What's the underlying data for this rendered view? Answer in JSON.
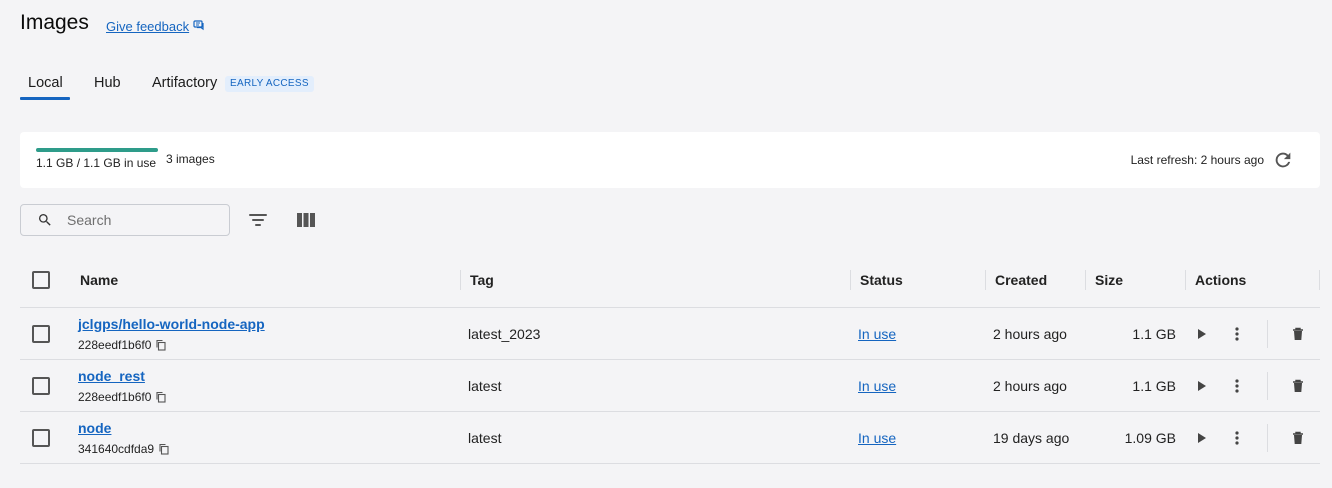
{
  "header": {
    "title": "Images",
    "feedback_label": "Give feedback"
  },
  "tabs": [
    {
      "label": "Local",
      "active": true
    },
    {
      "label": "Hub",
      "active": false
    },
    {
      "label": "Artifactory",
      "active": false,
      "badge": "EARLY ACCESS"
    }
  ],
  "disk": {
    "usage_text": "1.1 GB / 1.1 GB in use",
    "usage_fraction": 1.0,
    "image_count": "3 images",
    "last_refresh": "Last refresh: 2 hours ago"
  },
  "toolbar": {
    "search_placeholder": "Search"
  },
  "table": {
    "columns": [
      "Name",
      "Tag",
      "Status",
      "Created",
      "Size",
      "Actions"
    ],
    "rows": [
      {
        "name": "jclgps/hello-world-node-app",
        "id": "228eedf1b6f0",
        "tag": "latest_2023",
        "status": "In use",
        "created": "2 hours ago",
        "size": "1.1 GB"
      },
      {
        "name": "node_rest",
        "id": "228eedf1b6f0",
        "tag": "latest",
        "status": "In use",
        "created": "2 hours ago",
        "size": "1.1 GB"
      },
      {
        "name": "node",
        "id": "341640cdfda9",
        "tag": "latest",
        "status": "In use",
        "created": "19 days ago",
        "size": "1.09 GB"
      }
    ]
  },
  "colors": {
    "accent": "#1565c0",
    "usage_bar": "#2e9c8a",
    "background": "#f4f4f6"
  },
  "icons": {
    "feedback": "feedback-icon",
    "refresh": "refresh-icon",
    "search": "search-icon",
    "filter": "filter-icon",
    "columns": "columns-icon",
    "copy": "copy-icon",
    "run": "play-icon",
    "more": "more-vertical-icon",
    "delete": "trash-icon"
  }
}
